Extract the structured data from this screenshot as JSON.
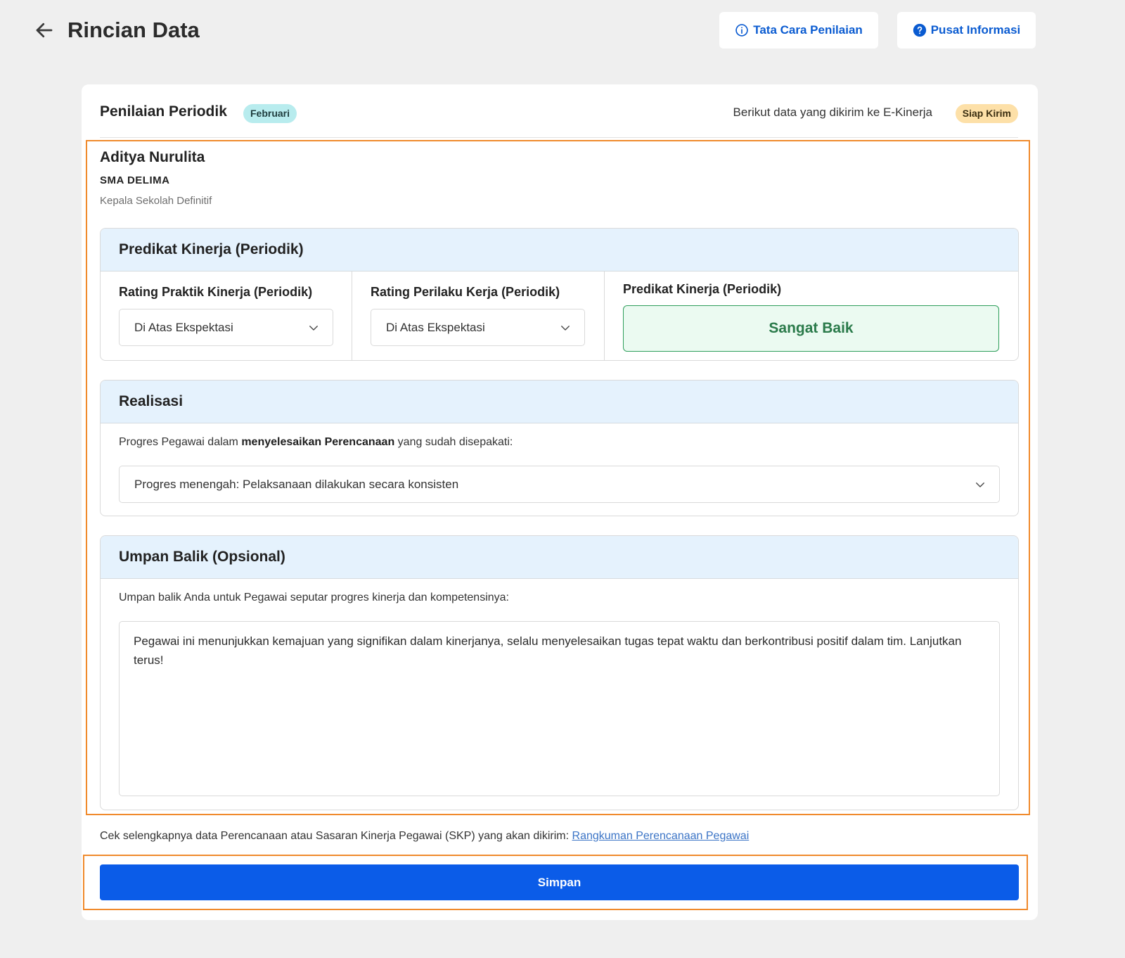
{
  "header": {
    "title": "Rincian Data",
    "tata_cara_label": "Tata Cara Penilaian",
    "pusat_informasi_label": "Pusat Informasi"
  },
  "card": {
    "title": "Penilaian Periodik",
    "month_badge": "Februari",
    "note": "Berikut data yang dikirim ke E-Kinerja",
    "status_badge": "Siap Kirim"
  },
  "person": {
    "name": "Aditya Nurulita",
    "school": "SMA DELIMA",
    "role": "Kepala Sekolah Definitif"
  },
  "predikat": {
    "section_title": "Predikat Kinerja (Periodik)",
    "praktik_label": "Rating Praktik Kinerja (Periodik)",
    "praktik_value": "Di Atas Ekspektasi",
    "perilaku_label": "Rating Perilaku Kerja (Periodik)",
    "perilaku_value": "Di Atas Ekspektasi",
    "result_label": "Predikat Kinerja (Periodik)",
    "result_value": "Sangat Baik"
  },
  "realisasi": {
    "section_title": "Realisasi",
    "prompt_prefix": "Progres Pegawai dalam ",
    "prompt_bold": "menyelesaikan Perencanaan",
    "prompt_suffix": " yang sudah disepakati:",
    "progress_value": "Progres menengah: Pelaksanaan dilakukan secara konsisten"
  },
  "umpan_balik": {
    "section_title": "Umpan Balik (Opsional)",
    "prompt": "Umpan balik Anda untuk Pegawai seputar progres kinerja dan kompetensinya:",
    "feedback_value": "Pegawai ini menunjukkan kemajuan yang signifikan dalam kinerjanya, selalu menyelesaikan tugas tepat waktu dan berkontribusi positif dalam tim. Lanjutkan terus!"
  },
  "footer": {
    "note_text": "Cek selengkapnya data Perencanaan atau Sasaran Kinerja Pegawai (SKP) yang akan dikirim: ",
    "link_text": "Rangkuman Perencanaan Pegawai",
    "save_label": "Simpan"
  },
  "colors": {
    "primary": "#0b5ce8",
    "link": "#0a5bd1",
    "highlight_border": "#f08a2c",
    "success_border": "#2e9e5b",
    "section_header_bg": "#e5f2fd"
  }
}
